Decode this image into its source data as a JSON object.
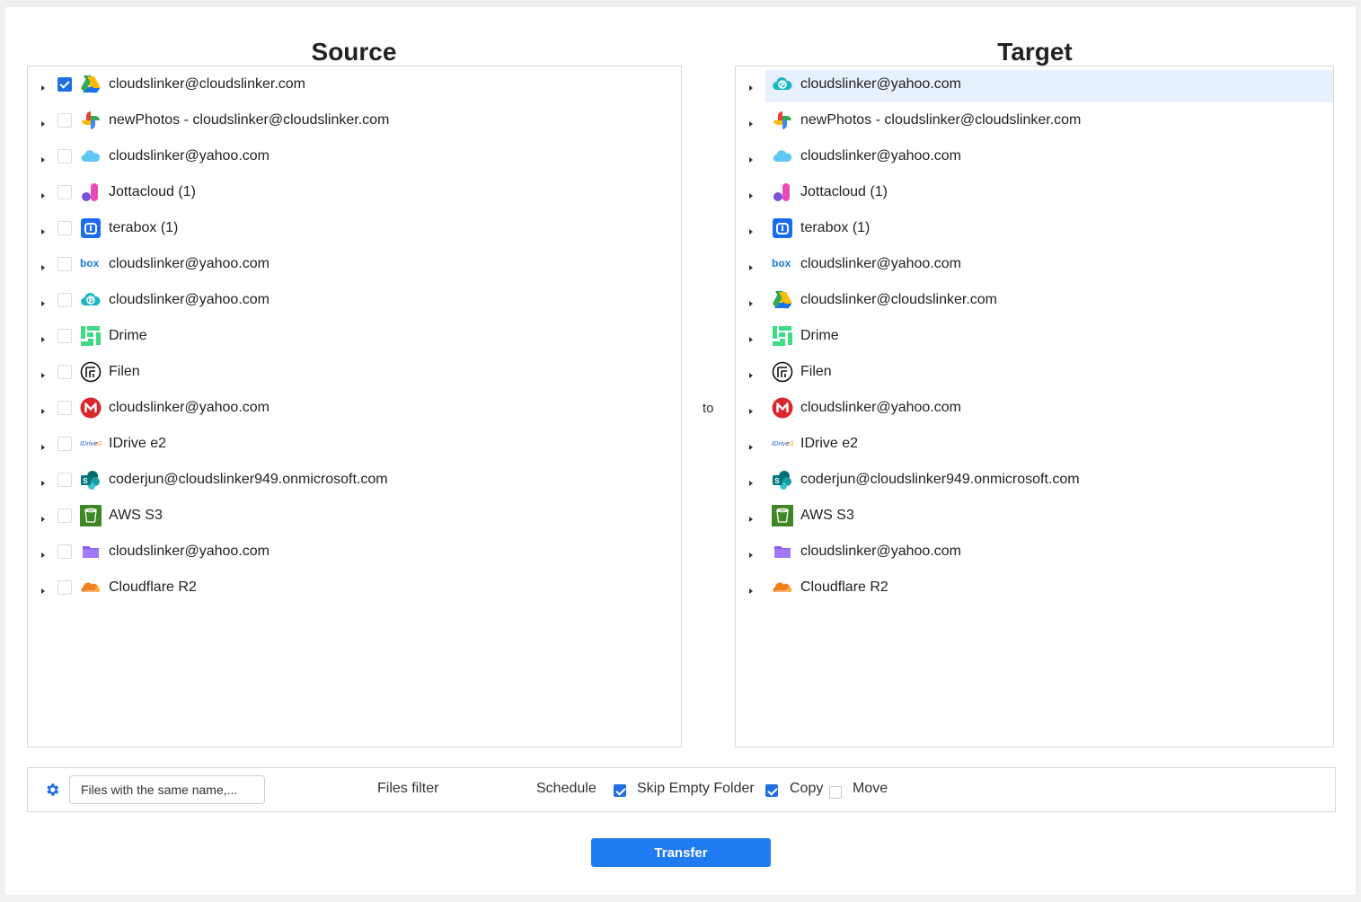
{
  "source": {
    "title": "Source",
    "items": [
      {
        "label": "cloudslinker@cloudslinker.com",
        "icon": "google-drive-icon",
        "checked": true
      },
      {
        "label": "newPhotos - cloudslinker@cloudslinker.com",
        "icon": "google-photos-icon",
        "checked": false
      },
      {
        "label": "cloudslinker@yahoo.com",
        "icon": "icloud-icon",
        "checked": false
      },
      {
        "label": "Jottacloud (1)",
        "icon": "jottacloud-icon",
        "checked": false
      },
      {
        "label": "terabox (1)",
        "icon": "terabox-icon",
        "checked": false
      },
      {
        "label": "cloudslinker@yahoo.com",
        "icon": "box-icon",
        "checked": false
      },
      {
        "label": "cloudslinker@yahoo.com",
        "icon": "pcloud-icon",
        "checked": false
      },
      {
        "label": "Drime",
        "icon": "drime-icon",
        "checked": false
      },
      {
        "label": "Filen",
        "icon": "filen-icon",
        "checked": false
      },
      {
        "label": "cloudslinker@yahoo.com",
        "icon": "mega-icon",
        "checked": false
      },
      {
        "label": "IDrive e2",
        "icon": "idrive-icon",
        "checked": false
      },
      {
        "label": "coderjun@cloudslinker949.onmicrosoft.com",
        "icon": "sharepoint-icon",
        "checked": false
      },
      {
        "label": "AWS S3",
        "icon": "aws-s3-icon",
        "checked": false
      },
      {
        "label": "cloudslinker@yahoo.com",
        "icon": "proton-drive-icon",
        "checked": false
      },
      {
        "label": "Cloudflare R2",
        "icon": "cloudflare-icon",
        "checked": false
      }
    ]
  },
  "connector": {
    "label": "to"
  },
  "target": {
    "title": "Target",
    "selected_index": 0,
    "items": [
      {
        "label": "cloudslinker@yahoo.com",
        "icon": "pcloud-icon"
      },
      {
        "label": "newPhotos - cloudslinker@cloudslinker.com",
        "icon": "google-photos-icon"
      },
      {
        "label": "cloudslinker@yahoo.com",
        "icon": "icloud-icon"
      },
      {
        "label": "Jottacloud (1)",
        "icon": "jottacloud-icon"
      },
      {
        "label": "terabox (1)",
        "icon": "terabox-icon"
      },
      {
        "label": "cloudslinker@yahoo.com",
        "icon": "box-icon"
      },
      {
        "label": "cloudslinker@cloudslinker.com",
        "icon": "google-drive-icon"
      },
      {
        "label": "Drime",
        "icon": "drime-icon"
      },
      {
        "label": "Filen",
        "icon": "filen-icon"
      },
      {
        "label": "cloudslinker@yahoo.com",
        "icon": "mega-icon"
      },
      {
        "label": "IDrive e2",
        "icon": "idrive-icon"
      },
      {
        "label": "coderjun@cloudslinker949.onmicrosoft.com",
        "icon": "sharepoint-icon"
      },
      {
        "label": "AWS S3",
        "icon": "aws-s3-icon"
      },
      {
        "label": "cloudslinker@yahoo.com",
        "icon": "proton-drive-icon"
      },
      {
        "label": "Cloudflare R2",
        "icon": "cloudflare-icon"
      }
    ]
  },
  "options": {
    "settings_icon": "gear-icon",
    "conflict_value": "Files with the same name,...",
    "files_filter_label": "Files filter",
    "schedule_label": "Schedule",
    "skip_empty_folder": {
      "label": "Skip Empty Folder",
      "checked": true
    },
    "copy": {
      "label": "Copy",
      "checked": true
    },
    "move": {
      "label": "Move",
      "checked": false
    }
  },
  "actions": {
    "transfer_label": "Transfer"
  },
  "colors": {
    "accent": "#1f7bf2",
    "selected_row": "#e6f1fd"
  }
}
